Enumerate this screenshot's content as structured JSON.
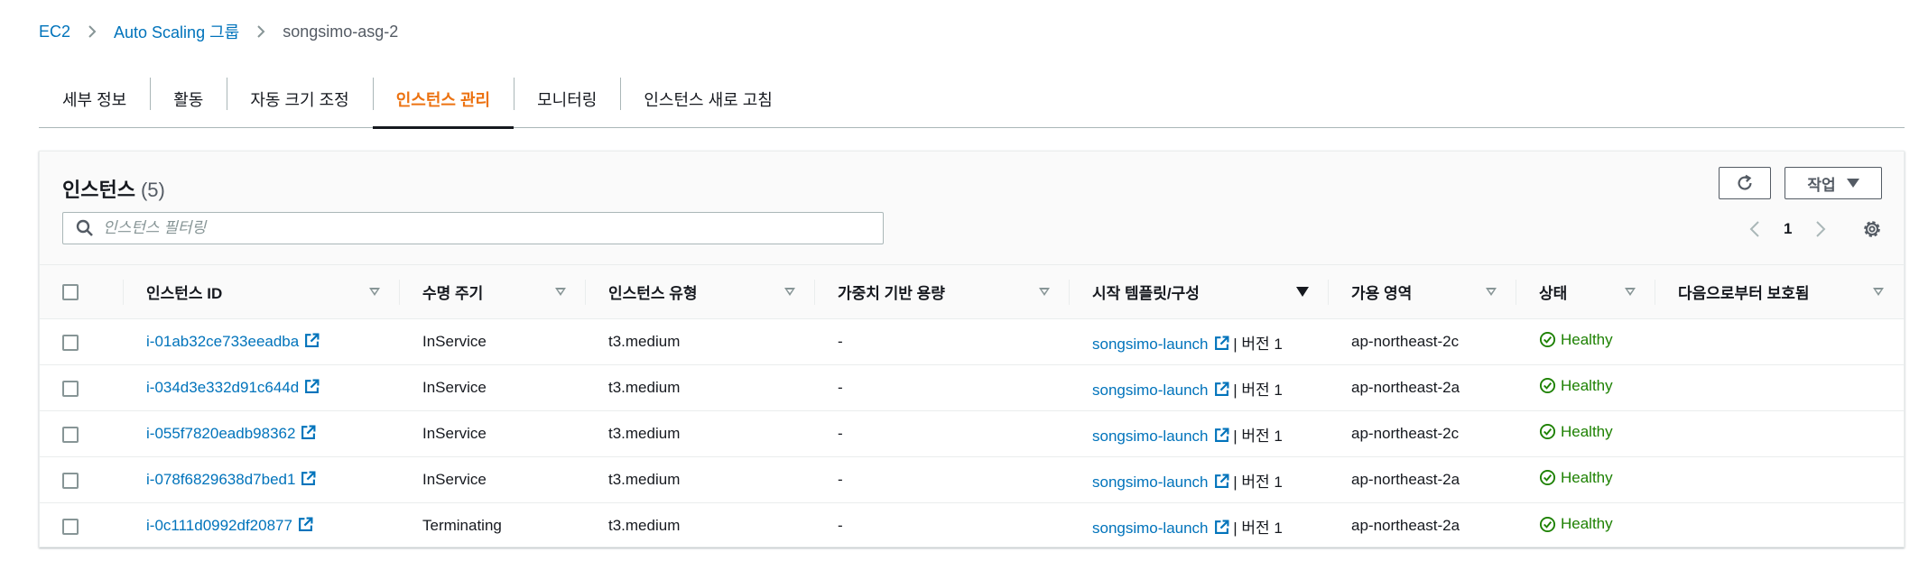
{
  "breadcrumb": {
    "items": [
      "EC2",
      "Auto Scaling 그룹"
    ],
    "current": "songsimo-asg-2"
  },
  "tabs": [
    "세부 정보",
    "활동",
    "자동 크기 조정",
    "인스턴스 관리",
    "모니터링",
    "인스턴스 새로 고침"
  ],
  "active_tab": "인스턴스 관리",
  "panel": {
    "title": "인스턴스",
    "count": "(5)",
    "actions_label": "작업",
    "filter_placeholder": "인스턴스 필터링",
    "page": "1"
  },
  "table": {
    "columns": [
      "인스턴스 ID",
      "수명 주기",
      "인스턴스 유형",
      "가중치 기반 용량",
      "시작 템플릿/구성",
      "가용 영역",
      "상태",
      "다음으로부터 보호됨"
    ],
    "sorted_column": "시작 템플릿/구성",
    "rows": [
      {
        "id": "i-01ab32ce733eeadba",
        "lifecycle": "InService",
        "type": "t3.medium",
        "weight": "-",
        "template": "songsimo-launch",
        "version": "| 버전 1",
        "az": "ap-northeast-2c",
        "status": "Healthy",
        "protected": ""
      },
      {
        "id": "i-034d3e332d91c644d",
        "lifecycle": "InService",
        "type": "t3.medium",
        "weight": "-",
        "template": "songsimo-launch",
        "version": "| 버전 1",
        "az": "ap-northeast-2a",
        "status": "Healthy",
        "protected": ""
      },
      {
        "id": "i-055f7820eadb98362",
        "lifecycle": "InService",
        "type": "t3.medium",
        "weight": "-",
        "template": "songsimo-launch",
        "version": "| 버전 1",
        "az": "ap-northeast-2c",
        "status": "Healthy",
        "protected": ""
      },
      {
        "id": "i-078f6829638d7bed1",
        "lifecycle": "InService",
        "type": "t3.medium",
        "weight": "-",
        "template": "songsimo-launch",
        "version": "| 버전 1",
        "az": "ap-northeast-2a",
        "status": "Healthy",
        "protected": ""
      },
      {
        "id": "i-0c111d0992df20877",
        "lifecycle": "Terminating",
        "type": "t3.medium",
        "weight": "-",
        "template": "songsimo-launch",
        "version": "| 버전 1",
        "az": "ap-northeast-2a",
        "status": "Healthy",
        "protected": ""
      }
    ]
  },
  "colors": {
    "link": "#0073bb",
    "active_tab": "#ec7211",
    "healthy": "#1d8102",
    "text": "#16191f"
  },
  "icons": [
    "chevron-right-icon",
    "refresh-icon",
    "caret-down-icon",
    "search-icon",
    "chevron-left-icon",
    "gear-icon",
    "external-link-icon",
    "check-circle-icon"
  ]
}
